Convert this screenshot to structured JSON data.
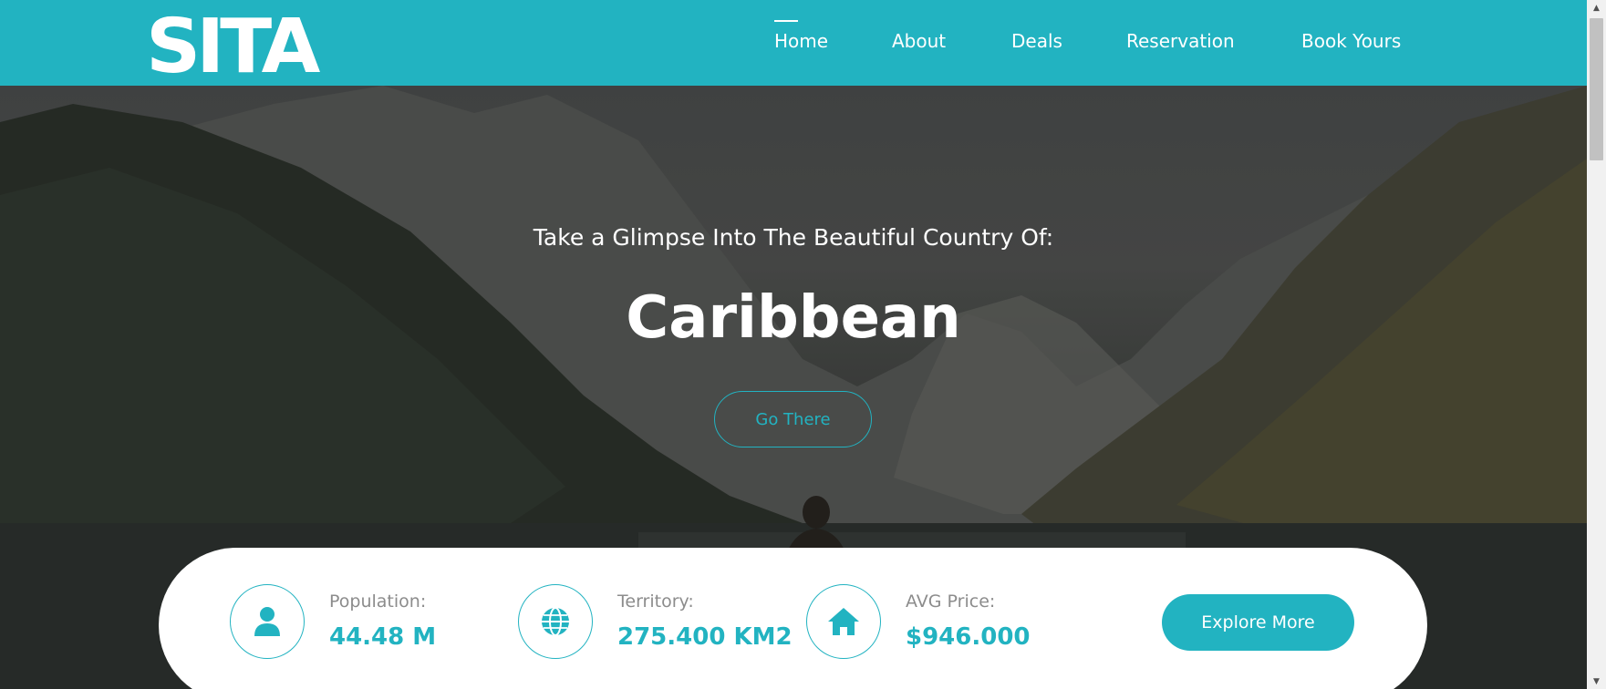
{
  "header": {
    "logo": "SITA",
    "nav": [
      {
        "label": "Home",
        "active": true
      },
      {
        "label": "About",
        "active": false
      },
      {
        "label": "Deals",
        "active": false
      },
      {
        "label": "Reservation",
        "active": false
      },
      {
        "label": "Book Yours",
        "active": false
      }
    ]
  },
  "hero": {
    "subtitle": "Take a Glimpse Into The Beautiful Country Of:",
    "title": "Caribbean",
    "cta": "Go There"
  },
  "stats": [
    {
      "icon": "user-icon",
      "label": "Population:",
      "value": "44.48 M"
    },
    {
      "icon": "globe-icon",
      "label": "Territory:",
      "value": "275.400 KM2"
    },
    {
      "icon": "home-icon",
      "label": "AVG Price:",
      "value": "$946.000"
    }
  ],
  "explore_label": "Explore More",
  "colors": {
    "accent": "#22b3c1",
    "white": "#ffffff",
    "muted": "#8c8c8c"
  }
}
